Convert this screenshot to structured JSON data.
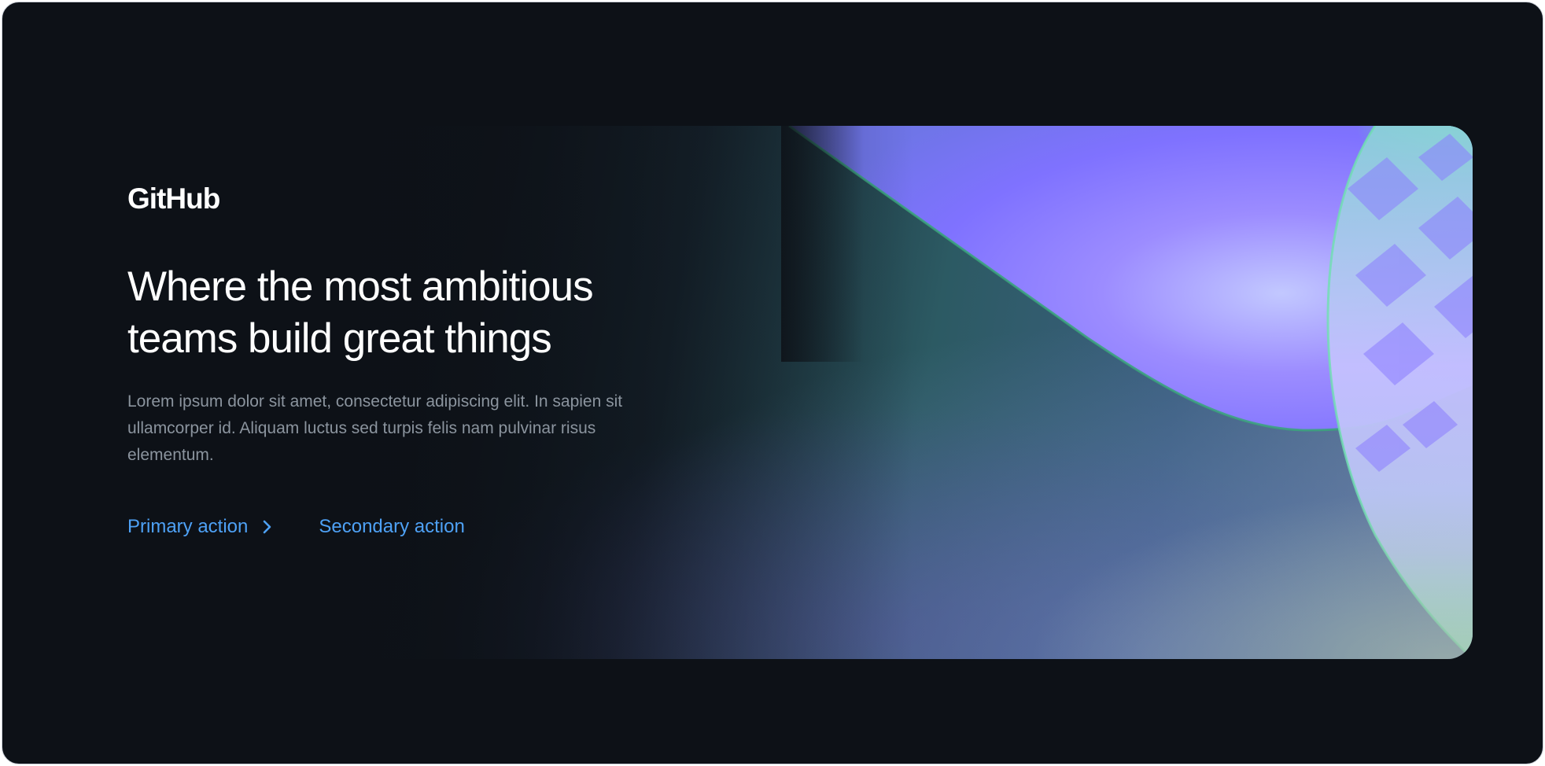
{
  "brand": {
    "logo_text": "GitHub"
  },
  "hero": {
    "headline": "Where the most ambitious teams build great things",
    "body": "Lorem ipsum dolor sit amet, consectetur adipiscing elit. In sapien sit ullamcorper id. Aliquam luctus sed turpis felis nam pulvinar risus elementum.",
    "primary_action": "Primary action",
    "secondary_action": "Secondary action"
  },
  "icons": {
    "primary_action_icon": "chevron-right-icon"
  },
  "colors": {
    "background": "#0d1117",
    "heading": "#ffffff",
    "body_text": "#8b949e",
    "link": "#4ea1f5",
    "accent_purple": "#7f7bff",
    "accent_green": "#5fe0a0"
  }
}
